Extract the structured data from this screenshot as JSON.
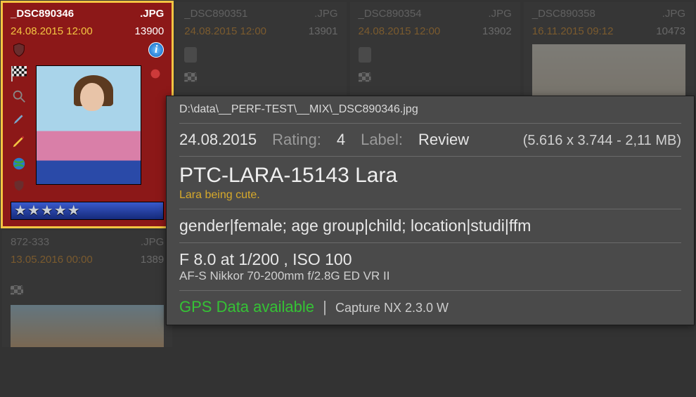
{
  "thumbs": [
    {
      "name": "_DSC890346",
      "ext": ".JPG",
      "datetime": "24.08.2015 12:00",
      "index": "13900",
      "selected": true
    },
    {
      "name": "_DSC890351",
      "ext": ".JPG",
      "datetime": "24.08.2015 12:00",
      "index": "13901",
      "selected": false
    },
    {
      "name": "_DSC890354",
      "ext": ".JPG",
      "datetime": "24.08.2015 12:00",
      "index": "13902",
      "selected": false
    },
    {
      "name": "_DSC890358",
      "ext": ".JPG",
      "datetime": "16.11.2015 09:12",
      "index": "10473",
      "selected": false
    }
  ],
  "row2thumb": {
    "name": "872-333",
    "ext": ".JPG",
    "datetime": "13.05.2016 00:00",
    "index": "1389"
  },
  "tooltip": {
    "path": "D:\\data\\__PERF-TEST\\__MIX\\_DSC890346.jpg",
    "date": "24.08.2015",
    "rating_label": "Rating:",
    "rating_value": "4",
    "label_label": "Label:",
    "label_value": "Review",
    "dimensions": "(5.616 x 3.744 - 2,11 MB)",
    "title": "PTC-LARA-15143 Lara",
    "description": "Lara being cute.",
    "keywords": "gender|female; age group|child; location|studi|ffm",
    "exposure": "F 8.0 at 1/200 , ISO 100",
    "lens": "AF-S Nikkor 70-200mm f/2.8G ED VR II",
    "gps": "GPS Data available",
    "software": "Capture NX 2.3.0 W"
  }
}
